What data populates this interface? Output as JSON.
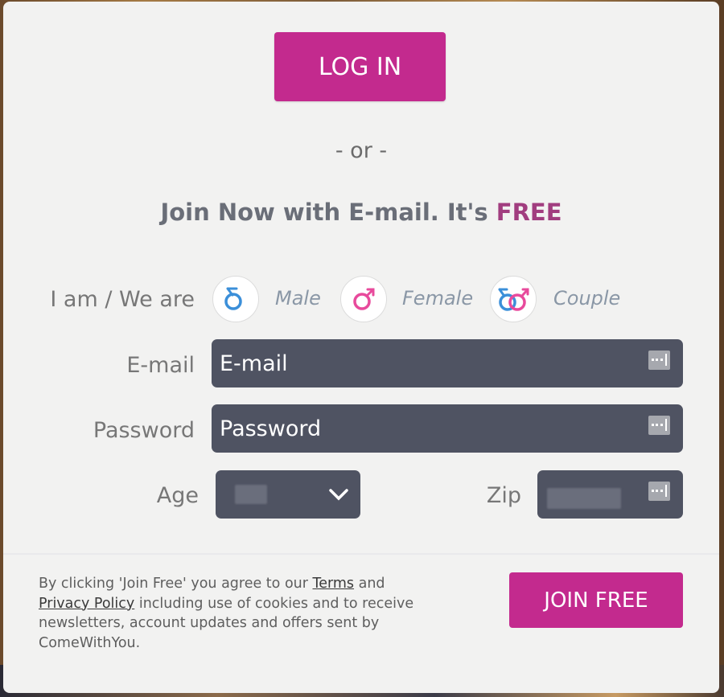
{
  "login": {
    "label": "LOG IN"
  },
  "separator": "- or -",
  "join_heading": {
    "prefix": "Join Now with E-mail. It's ",
    "highlight": "FREE"
  },
  "gender": {
    "label": "I am / We are",
    "options": [
      {
        "label": "Male",
        "icon": "male-icon"
      },
      {
        "label": "Female",
        "icon": "female-icon"
      },
      {
        "label": "Couple",
        "icon": "couple-icon"
      }
    ]
  },
  "email": {
    "label": "E-mail",
    "placeholder": "E-mail",
    "value": ""
  },
  "password": {
    "label": "Password",
    "placeholder": "Password",
    "value": ""
  },
  "age": {
    "label": "Age"
  },
  "zip": {
    "label": "Zip"
  },
  "disclaimer": {
    "part1": "By clicking 'Join Free' you agree to our ",
    "terms": "Terms",
    "part2": " and ",
    "privacy": "Privacy Policy",
    "part3": " including use of cookies and to receive newsletters, account updates and offers sent by ComeWithYou."
  },
  "join": {
    "label": "JOIN FREE"
  },
  "colors": {
    "accent": "#c32a8e",
    "field_bg": "#4f5362",
    "male": "#3b8fd9",
    "female": "#e84a9c",
    "free": "#a13d7f"
  }
}
